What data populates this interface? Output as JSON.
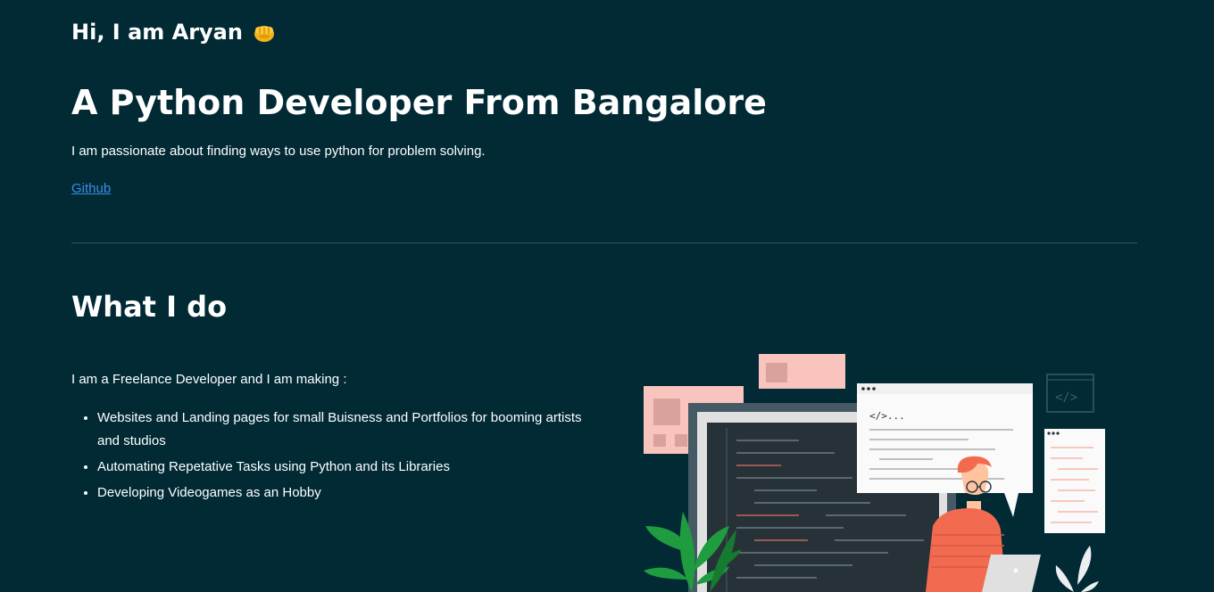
{
  "hero": {
    "greeting": "Hi, I am Aryan",
    "headline": "A Python Developer From Bangalore",
    "tagline": "I am passionate about finding ways to use python for problem solving.",
    "github_label": "Github"
  },
  "what_i_do": {
    "title": "What I do",
    "intro": "I am a Freelance Developer and I am making :",
    "items": [
      "Websites and Landing pages for small Buisness and Portfolios for booming artists and studios",
      "Automating Repetative Tasks using Python and its Libraries",
      "Developing Videogames as an Hobby"
    ]
  },
  "illustration": {
    "code_tag": "</>...",
    "window_icon": "code-window-icon"
  },
  "colors": {
    "background": "#012a35",
    "text": "#ffffff",
    "link": "#3a8ee6",
    "divider": "#2e5560",
    "accent_pink": "#f8c4bd",
    "accent_orange": "#f26b50",
    "monitor_dark": "#263238",
    "leaf_green": "#1e9c3f"
  },
  "icons": {
    "greeting_icon": "fist-icon"
  }
}
